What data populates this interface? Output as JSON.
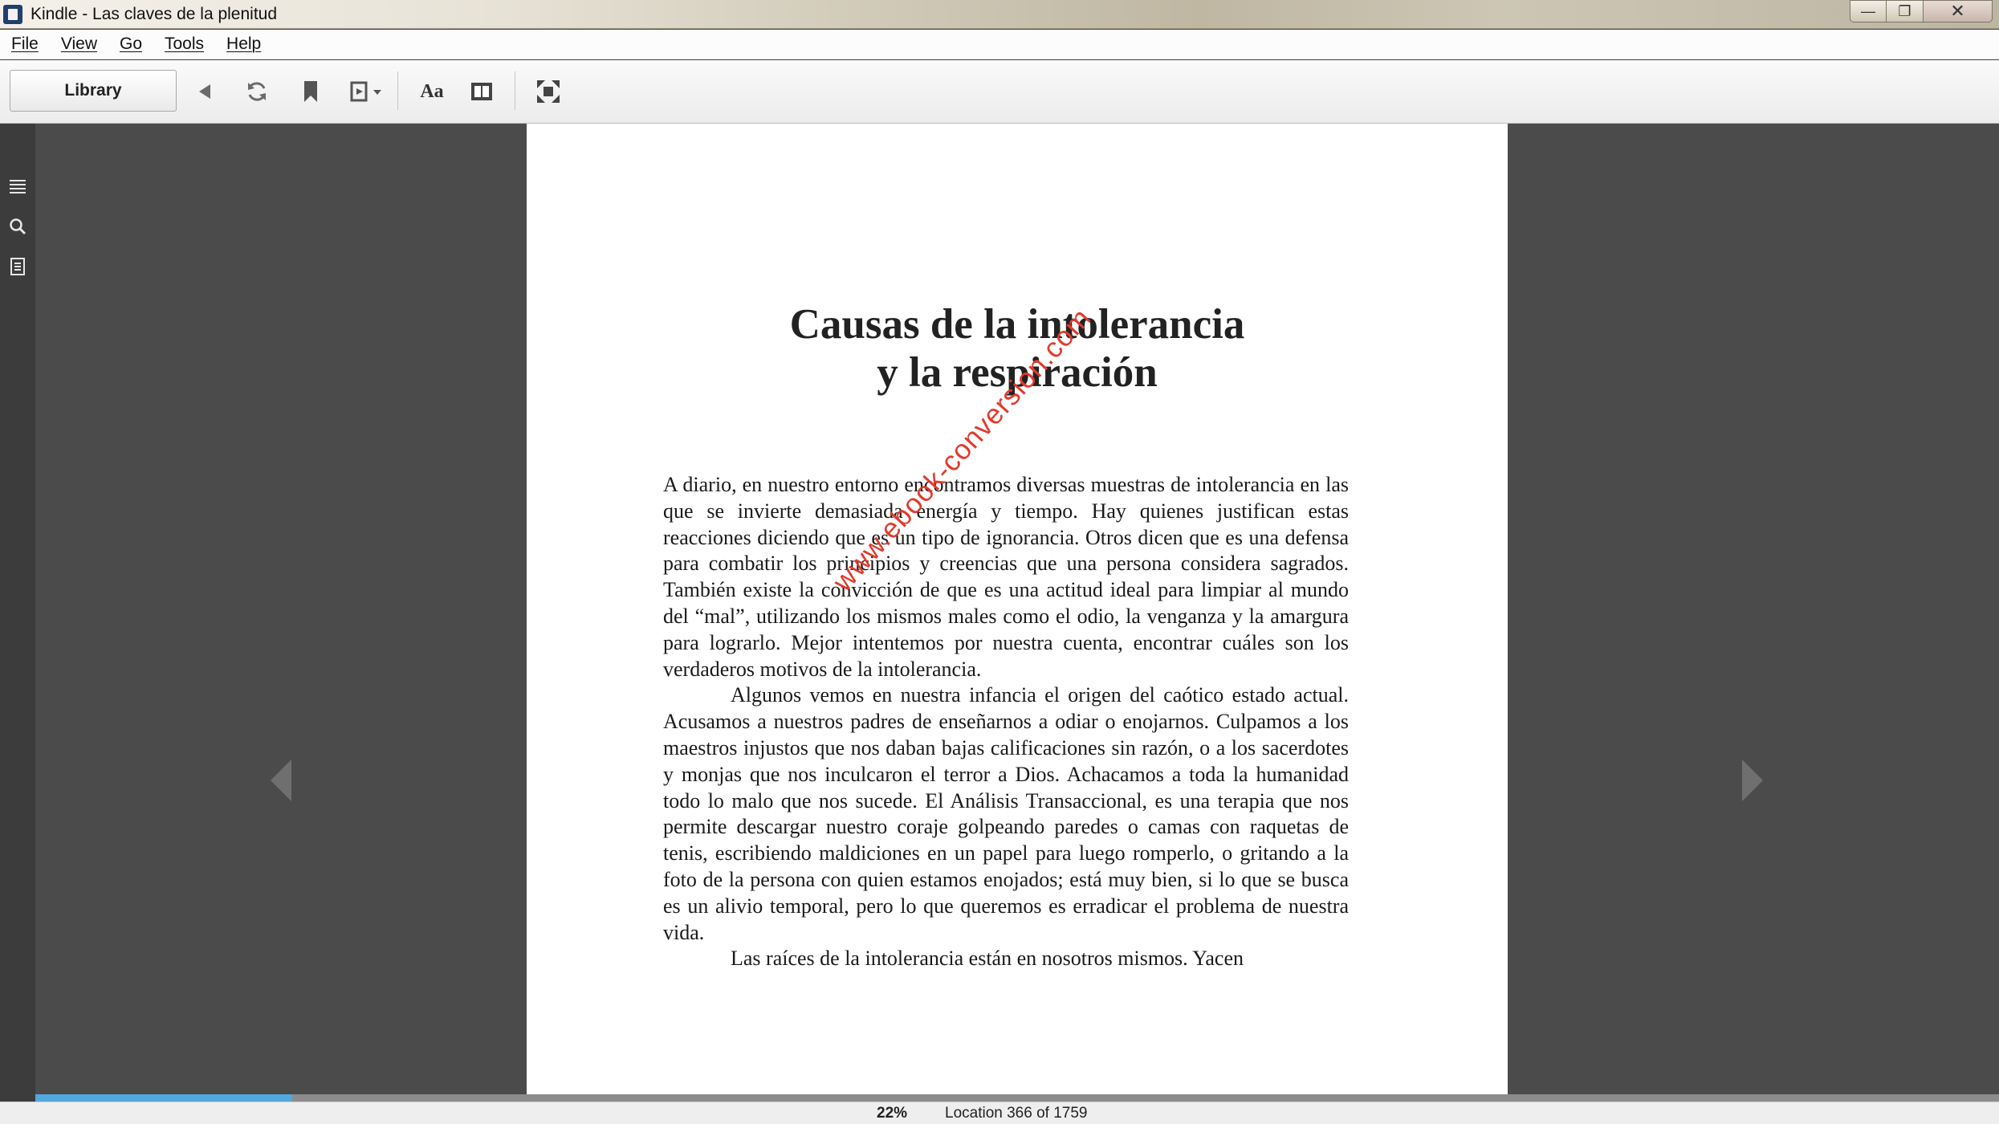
{
  "window": {
    "title": "Kindle - Las claves de la plenitud",
    "minimize_glyph": "—",
    "maximize_glyph": "❐",
    "close_glyph": "✕"
  },
  "menu": {
    "items": [
      {
        "label": "File"
      },
      {
        "label": "View"
      },
      {
        "label": "Go"
      },
      {
        "label": "Tools"
      },
      {
        "label": "Help"
      }
    ]
  },
  "toolbar": {
    "library_label": "Library",
    "font_label": "Aa",
    "icons": [
      "back-arrow-icon",
      "sync-icon",
      "bookmark-icon",
      "goto-icon",
      "font-settings-icon",
      "view-mode-icon",
      "fullscreen-icon"
    ]
  },
  "sidebar": {
    "icons": [
      "table-of-contents-icon",
      "search-icon",
      "notes-icon"
    ]
  },
  "book": {
    "chapter_title_line1": "Causas de la intolerancia",
    "chapter_title_line2": "y la respiración",
    "paragraphs": [
      "A diario, en nuestro entorno encontramos diversas muestras de intolerancia en las que se invierte demasiada energía y tiempo. Hay quienes justifican estas reacciones diciendo que es un tipo de ignorancia. Otros dicen que es una defensa para combatir los principios y creencias que una persona considera sagrados. También existe la convicción de que es una actitud ideal para limpiar al mundo del “mal”, utilizando los mismos males como el odio, la venganza y la amargura para lograrlo. Mejor intentemos por nuestra cuenta, encontrar cuáles son los verdaderos motivos de la intolerancia.",
      "Algunos vemos en nuestra infancia el origen del caótico estado actual. Acusamos a nuestros padres de enseñarnos a odiar o enojarnos. Culpamos a los maestros injustos que nos daban bajas calificaciones sin razón, o a los sacerdotes y monjas que nos inculcaron el terror a Dios. Achacamos a toda la humanidad todo lo malo que nos sucede. El Análisis Transaccional, es una terapia que nos permite descargar nuestro coraje golpeando paredes o camas con raquetas de tenis, escribiendo maldiciones en un papel para luego romperlo, o gritando a la foto de la persona con quien estamos enojados; está muy bien, si lo que se busca es un alivio temporal, pero lo que queremos es erradicar el problema de nuestra vida.",
      "Las raíces de la intolerancia están en nosotros mismos. Yacen"
    ],
    "watermark": "www.ebook-conversion.com"
  },
  "status": {
    "percent_label": "22%",
    "progress_fraction": 0.131,
    "location_label": "Location 366 of 1759"
  },
  "colors": {
    "progress_fill": "#51a9e0",
    "watermark": "#e23a2c",
    "reading_background": "#4b4b4b"
  }
}
